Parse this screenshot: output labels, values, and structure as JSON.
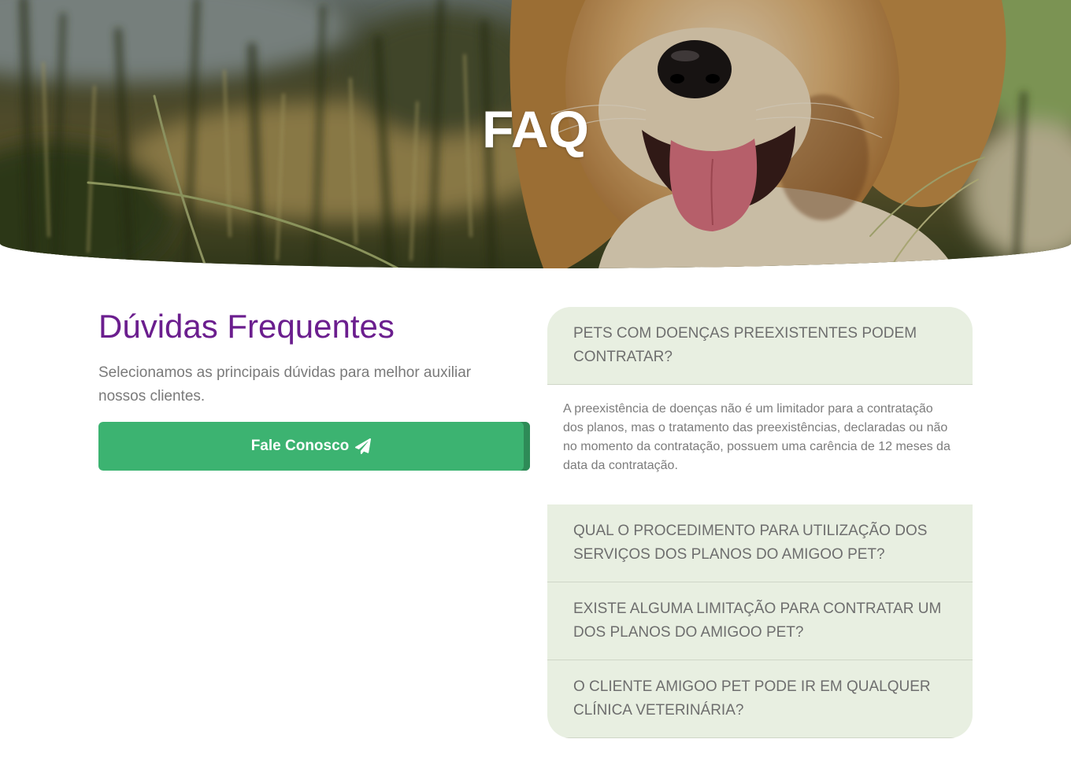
{
  "hero": {
    "title": "FAQ"
  },
  "intro": {
    "heading": "Dúvidas Frequentes",
    "description": "Selecionamos as principais dúvidas para melhor auxiliar nossos clientes.",
    "contact_button": {
      "label": "Fale Conosco",
      "icon": "paper-plane-icon"
    }
  },
  "faq": {
    "items": [
      {
        "question": "PETS COM DOENÇAS PREEXISTENTES PODEM CONTRATAR?",
        "expanded": true,
        "answer": "A preexistência de doenças não é um limitador para a contratação dos planos, mas o tratamento das preexistências, declaradas ou não no momento da contratação, possuem uma carência de 12 meses da data da contratação."
      },
      {
        "question": "QUAL O PROCEDIMENTO PARA UTILIZAÇÃO DOS SERVIÇOS DOS PLANOS DO AMIGOO PET?",
        "expanded": false
      },
      {
        "question": "EXISTE ALGUMA LIMITAÇÃO PARA CONTRATAR UM DOS PLANOS DO AMIGOO PET?",
        "expanded": false
      },
      {
        "question": "O CLIENTE AMIGOO PET PODE IR EM QUALQUER CLÍNICA VETERINÁRIA?",
        "expanded": false
      }
    ]
  },
  "colors": {
    "heading_purple": "#6b1e8e",
    "button_green": "#3cb371",
    "button_green_dark": "#2e8b57",
    "accordion_bg": "#e8efe1",
    "divider": "#cfd6c7",
    "text_gray": "#7a7a7a",
    "question_gray": "#6e6e6e",
    "answer_gray": "#7c7c7c"
  }
}
